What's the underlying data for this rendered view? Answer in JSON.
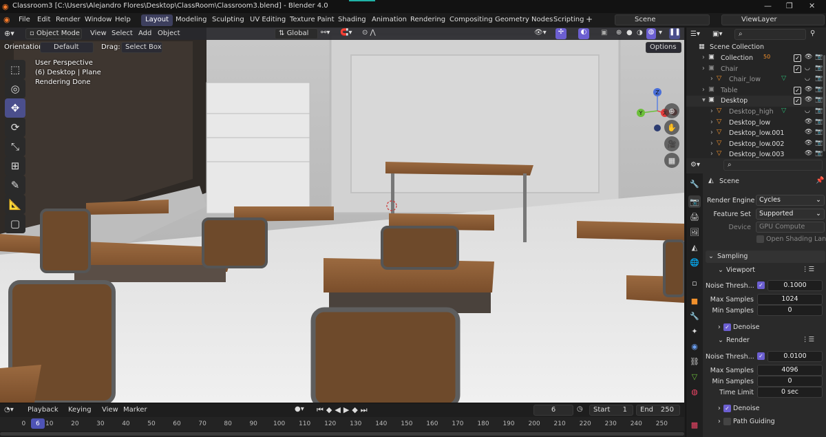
{
  "title": {
    "text": "Classroom3 [C:\\Users\\Alejandro Flores\\Desktop\\ClassRoom\\Classroom3.blend] - Blender 4.0"
  },
  "menu": [
    "File",
    "Edit",
    "Render",
    "Window",
    "Help"
  ],
  "workspaces": [
    "Layout",
    "Modeling",
    "Sculpting",
    "UV Editing",
    "Texture Paint",
    "Shading",
    "Animation",
    "Rendering",
    "Compositing",
    "Geometry Nodes",
    "Scripting"
  ],
  "scene": {
    "name": "Scene",
    "view_layer": "ViewLayer"
  },
  "viewport": {
    "mode": "Object Mode",
    "menus": [
      "View",
      "Select",
      "Add",
      "Object"
    ],
    "transform": "Global",
    "orientation_label": "Orientation:",
    "orientation": "Default",
    "drag_label": "Drag:",
    "drag": "Select Box",
    "options": "Options",
    "overlay": [
      "User Perspective",
      "(6) Desktop | Plane",
      "Rendering Done"
    ],
    "gizmo": {
      "x": "X",
      "y": "Y",
      "z": "Z"
    }
  },
  "timeline": {
    "menus": [
      "Playback",
      "Keying",
      "View",
      "Marker"
    ],
    "current_frame": "6",
    "start_label": "Start",
    "start": "1",
    "end_label": "End",
    "end": "250",
    "ticks": [
      "0",
      "10",
      "20",
      "30",
      "40",
      "50",
      "60",
      "70",
      "80",
      "90",
      "100",
      "110",
      "120",
      "130",
      "140",
      "150",
      "160",
      "170",
      "180",
      "190",
      "200",
      "210",
      "220",
      "230",
      "240",
      "250"
    ]
  },
  "outliner": {
    "root": "Scene Collection",
    "items": [
      {
        "label": "Collection",
        "dim": false
      },
      {
        "label": "Chair",
        "dim": true
      },
      {
        "label": "Chair_low",
        "dim": true
      },
      {
        "label": "Table",
        "dim": true
      },
      {
        "label": "Desktop",
        "dim": false
      },
      {
        "label": "Desktop_high",
        "dim": true
      },
      {
        "label": "Desktop_low",
        "dim": false
      },
      {
        "label": "Desktop_low.001",
        "dim": false
      },
      {
        "label": "Desktop_low.002",
        "dim": false
      },
      {
        "label": "Desktop_low.003",
        "dim": false
      }
    ],
    "collection_badge": "50"
  },
  "properties": {
    "context": "Scene",
    "render_engine_label": "Render Engine",
    "render_engine": "Cycles",
    "feature_set_label": "Feature Set",
    "feature_set": "Supported",
    "device_label": "Device",
    "device": "GPU Compute",
    "osl_label": "Open Shading Lan...",
    "sampling": "Sampling",
    "viewport_section": "Viewport",
    "v_noise_label": "Noise Thresh...",
    "v_noise": "0.1000",
    "v_max_label": "Max Samples",
    "v_max": "1024",
    "v_min_label": "Min Samples",
    "v_min": "0",
    "v_denoise": "Denoise",
    "render_section": "Render",
    "r_noise_label": "Noise Thresh...",
    "r_noise": "0.0100",
    "r_max_label": "Max Samples",
    "r_max": "4096",
    "r_min_label": "Min Samples",
    "r_min": "0",
    "time_limit_label": "Time Limit",
    "time_limit": "0 sec",
    "r_denoise": "Denoise",
    "path_guiding": "Path Guiding"
  },
  "colors": {
    "accent": "#4b4f8c",
    "check": "#6c5fd1",
    "wood": "#8a5a33",
    "playhead": "#4e53b5"
  }
}
